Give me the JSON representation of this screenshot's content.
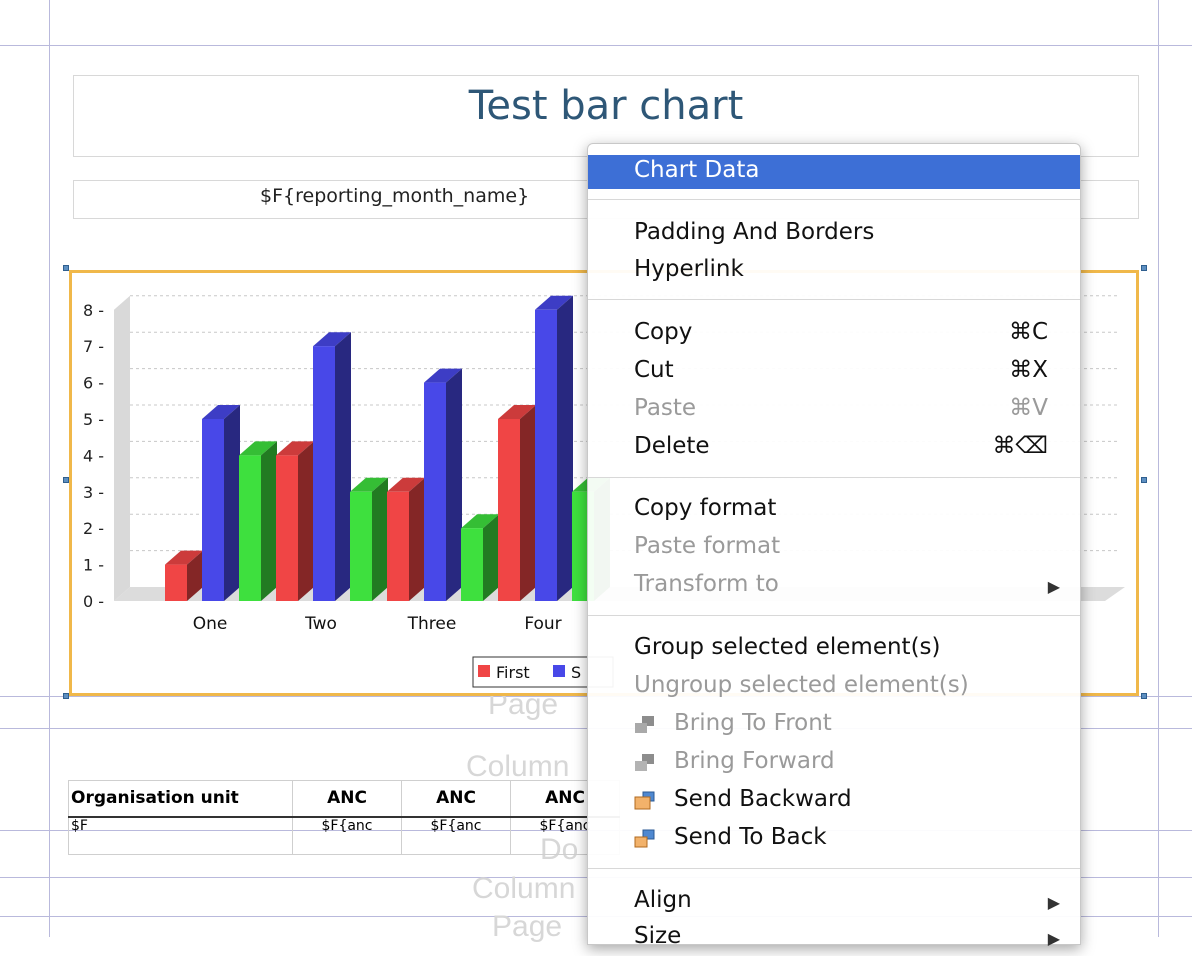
{
  "report": {
    "title": "Test bar chart",
    "subtitle": "$F{reporting_month_name}",
    "watermarks": [
      "Page",
      "Column",
      "Do",
      "Column",
      "Page"
    ]
  },
  "chart_data": {
    "type": "bar",
    "categories": [
      "One",
      "Two",
      "Three",
      "Four"
    ],
    "series": [
      {
        "name": "First",
        "values": [
          1,
          4,
          3,
          5
        ],
        "color": "#f04545"
      },
      {
        "name": "S",
        "values": [
          5,
          7,
          6,
          8
        ],
        "color": "#4848e8"
      },
      {
        "values": [
          4,
          3,
          2,
          3
        ],
        "color": "#3ee03e"
      }
    ],
    "ylim": [
      0,
      8
    ],
    "yticks": [
      "0",
      "1",
      "2",
      "3",
      "4",
      "5",
      "6",
      "7",
      "8"
    ],
    "grid": true,
    "legend": "bottom"
  },
  "table": {
    "headers": [
      "Organisation unit",
      "ANC",
      "ANC",
      "ANC"
    ],
    "row": [
      "$F",
      "$F{anc",
      "$F{anc",
      "$F{anc"
    ]
  },
  "menu": {
    "chart_data": "Chart Data",
    "padding": "Padding And Borders",
    "hyperlink": "Hyperlink",
    "copy": "Copy",
    "copy_sc": "⌘C",
    "cut": "Cut",
    "cut_sc": "⌘X",
    "paste": "Paste",
    "paste_sc": "⌘V",
    "delete": "Delete",
    "delete_sc": "⌘⌫",
    "copy_format": "Copy format",
    "paste_format": "Paste format",
    "transform": "Transform to",
    "group": "Group selected element(s)",
    "ungroup": "Ungroup selected element(s)",
    "front": "Bring To Front",
    "forward": "Bring Forward",
    "backward": "Send Backward",
    "back": "Send To Back",
    "align": "Align",
    "size": "Size",
    "submenu_arrow": "▶",
    "selected_color": "#3d6fd6",
    "icons": [
      "bring-to-front-icon",
      "bring-forward-icon",
      "send-backward-icon",
      "send-to-back-icon"
    ]
  }
}
